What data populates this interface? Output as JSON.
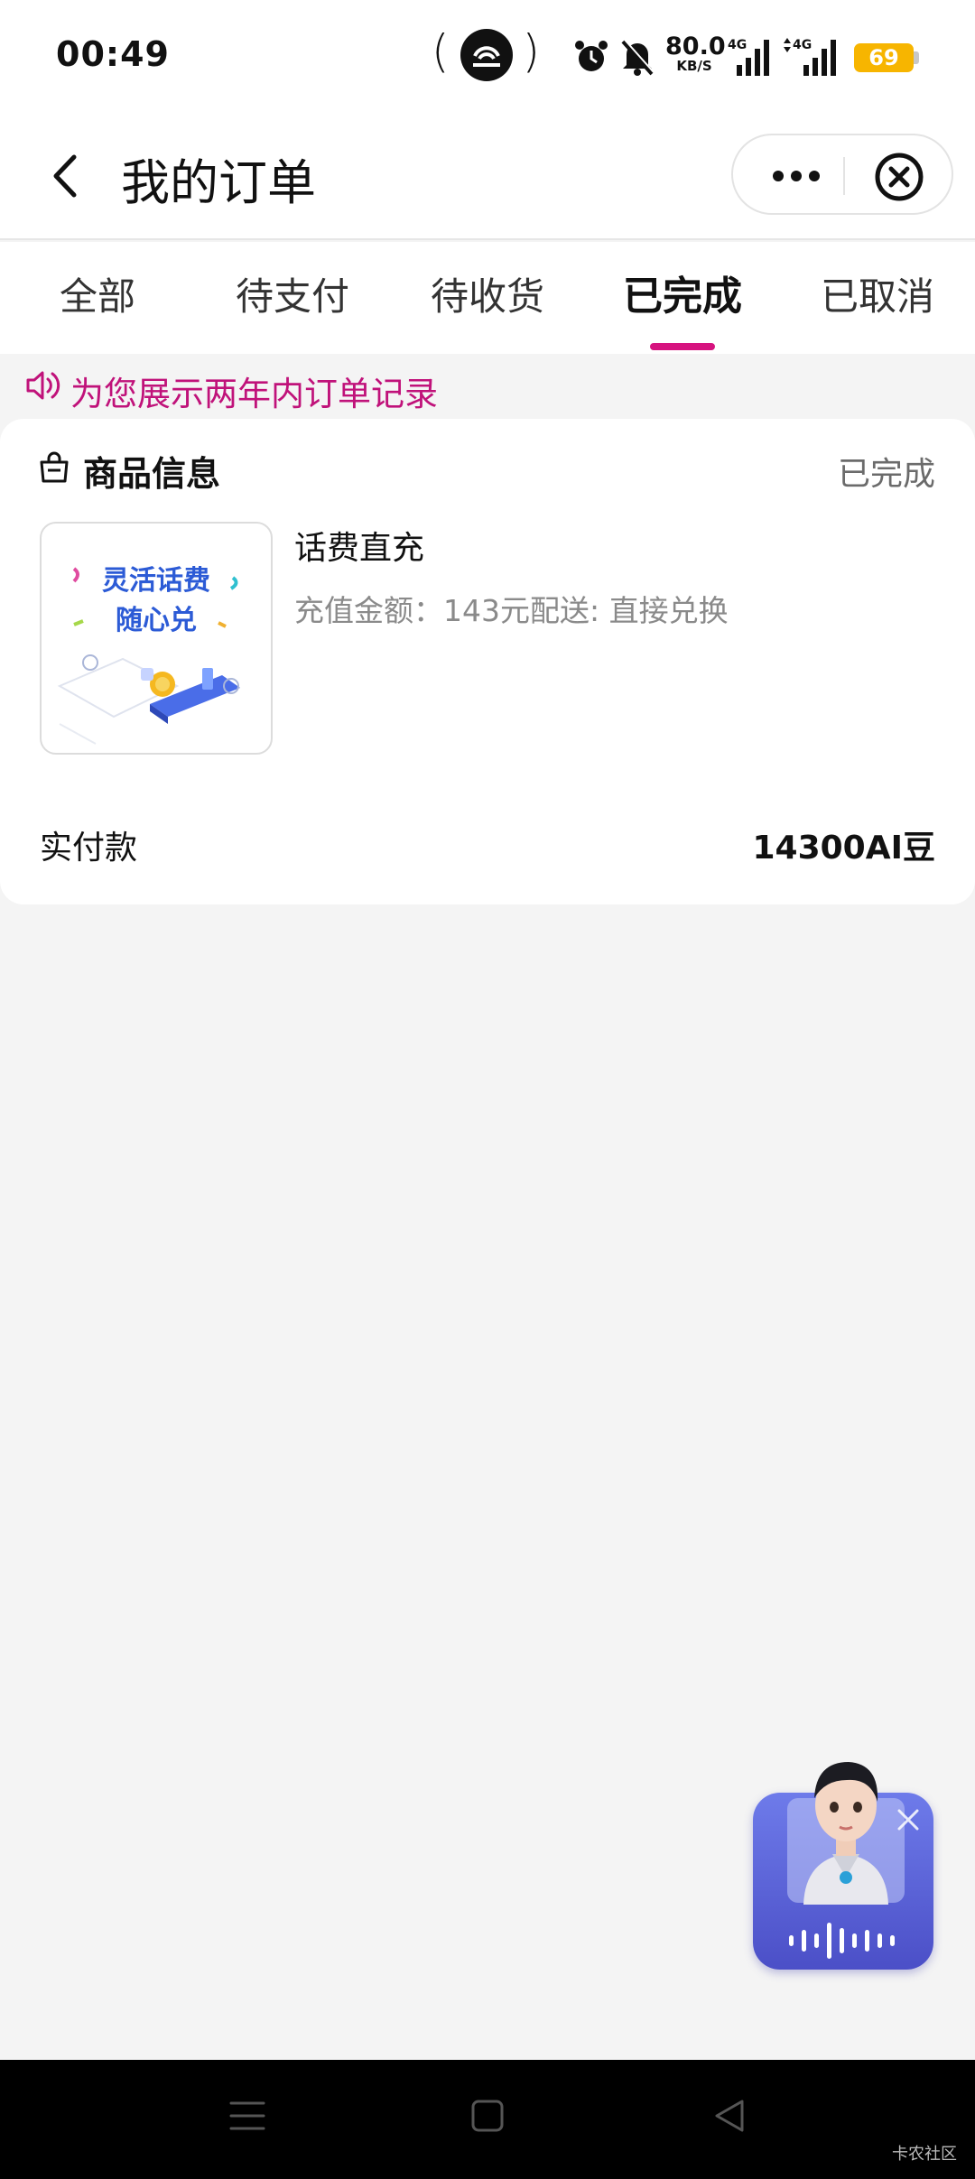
{
  "status_bar": {
    "time": "00:49",
    "net_speed_value": "80.0",
    "net_speed_unit": "KB/S",
    "sim1_label": "4G",
    "sim2_label": "4G",
    "battery": "69"
  },
  "header": {
    "title": "我的订单"
  },
  "tabs": [
    {
      "label": "全部"
    },
    {
      "label": "待支付"
    },
    {
      "label": "待收货"
    },
    {
      "label": "已完成",
      "active": true
    },
    {
      "label": "已取消"
    }
  ],
  "notice": {
    "text": "为您展示两年内订单记录"
  },
  "order": {
    "section_title": "商品信息",
    "status": "已完成",
    "thumbnail_line1": "灵活话费",
    "thumbnail_line2": "随心兑",
    "product_name": "话费直充",
    "product_desc": "充值金额：143元配送: 直接兑换",
    "paid_label": "实付款",
    "paid_value": "14300AI豆"
  },
  "watermark": "卡农社区",
  "colors": {
    "accent": "#d6137f",
    "notice_text": "#c0127a",
    "battery": "#f7b500",
    "assistant_gradient_top": "#6e7bea",
    "assistant_gradient_bottom": "#4b4fc7"
  }
}
